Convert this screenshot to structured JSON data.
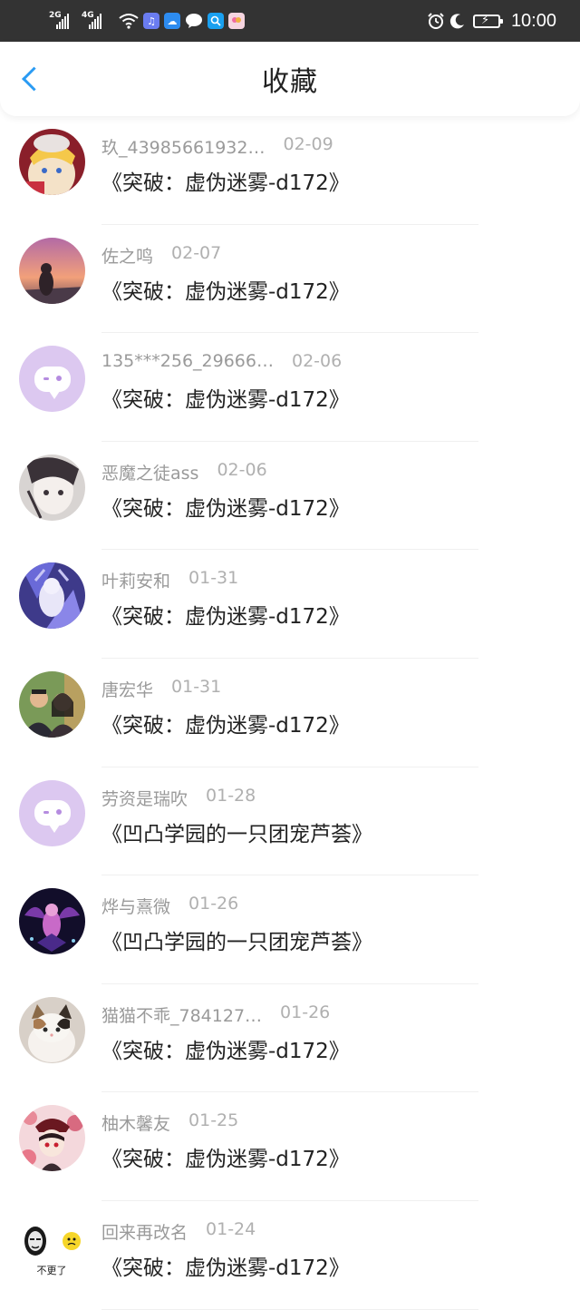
{
  "status_bar": {
    "signal1_label": "2G",
    "signal2_label": "4G",
    "time": "10:00"
  },
  "header": {
    "title": "收藏"
  },
  "items": [
    {
      "name": "玖_43985661932…",
      "date": "02-09",
      "work": "《突破：虚伪迷雾-d172》",
      "avatar": "anime-girl-red"
    },
    {
      "name": "佐之鸣",
      "date": "02-07",
      "work": "《突破：虚伪迷雾-d172》",
      "avatar": "sunset-photo"
    },
    {
      "name": "135***256_29666…",
      "date": "02-06",
      "work": "《突破：虚伪迷雾-d172》",
      "avatar": "default-chat"
    },
    {
      "name": "恶魔之徒ass",
      "date": "02-06",
      "work": "《突破：虚伪迷雾-d172》",
      "avatar": "sketch-girl"
    },
    {
      "name": "叶莉安和",
      "date": "01-31",
      "work": "《突破：虚伪迷雾-d172》",
      "avatar": "blue-anime"
    },
    {
      "name": "唐宏华",
      "date": "01-31",
      "work": "《突破：虚伪迷雾-d172》",
      "avatar": "couple-photo"
    },
    {
      "name": "劳资是瑞吹",
      "date": "01-28",
      "work": "《凹凸学园的一只团宠芦荟》",
      "avatar": "default-chat"
    },
    {
      "name": "烨与熹微",
      "date": "01-26",
      "work": "《凹凸学园的一只团宠芦荟》",
      "avatar": "dark-purple-art"
    },
    {
      "name": "猫猫不乖_784127…",
      "date": "01-26",
      "work": "《突破：虚伪迷雾-d172》",
      "avatar": "kitten-photo"
    },
    {
      "name": "柚木馨友",
      "date": "01-25",
      "work": "《突破：虚伪迷雾-d172》",
      "avatar": "red-floral-anime"
    },
    {
      "name": "回来再改名",
      "date": "01-24",
      "work": "《突破：虚伪迷雾-d172》",
      "avatar": "meme-sticker",
      "avatar_text": "不更了"
    }
  ],
  "colors": {
    "status_bar_bg": "#333333",
    "back_arrow": "#2a9bf3",
    "name_text": "#9a9a9a",
    "date_text": "#b0b0b0",
    "work_text": "#222222",
    "default_avatar": "#dcc8f0"
  }
}
